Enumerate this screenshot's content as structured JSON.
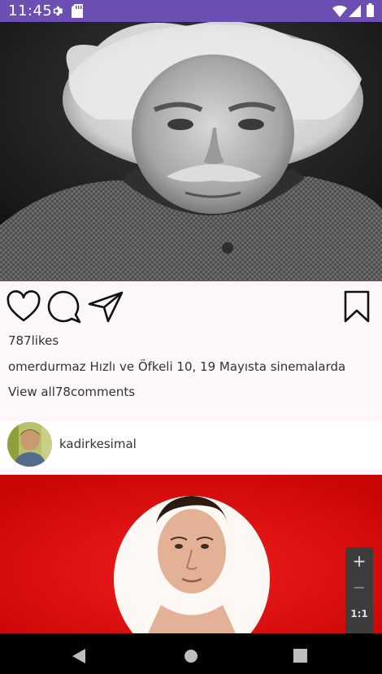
{
  "status_bar": {
    "time": "11:45",
    "icons": [
      "gear-icon",
      "sd-card-icon",
      "wifi-icon",
      "signal-icon",
      "battery-icon"
    ]
  },
  "post": {
    "actions": [
      "heart-icon",
      "comment-icon",
      "share-icon",
      "bookmark-icon"
    ],
    "likes": "787likes",
    "caption_user": "omerdurmaz",
    "caption_text": "Hızlı ve Öfkeli 10, 19 Mayısta sinemalarda",
    "comments_prefix": "View all",
    "comments_count": "78",
    "comments_suffix": "comments"
  },
  "next_post": {
    "author": "kadirkesimal"
  },
  "zoom_controls": {
    "zoom_in": "+",
    "zoom_out": "−",
    "ratio": "1:1"
  },
  "colors": {
    "status_bar": "#6b4fb3",
    "post2_bg": "#d80a0a",
    "background": "#fdf7fb"
  }
}
